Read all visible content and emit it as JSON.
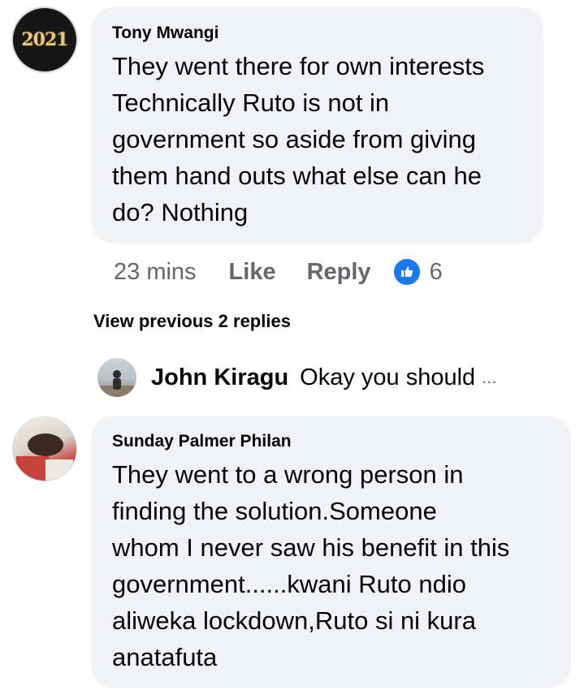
{
  "comments": [
    {
      "author": "Tony Mwangi",
      "avatar_text": "2021",
      "text": "They went there for own interests\nTechnically Ruto is not in\ngovernment so aside from giving\nthem hand outs what else can he\ndo? Nothing",
      "time": "23 mins",
      "like_label": "Like",
      "reply_label": "Reply",
      "reaction_icon": "thumbs-up-icon",
      "reaction_count": "6",
      "view_previous": "View previous 2 replies",
      "latest_reply": {
        "author": "John Kiragu",
        "text": "Okay you should",
        "ellipsis": "..."
      }
    },
    {
      "author": "Sunday Palmer Philan",
      "text": "They went to a wrong person in\nfinding the solution.Someone\nwhom I never saw his benefit in this\ngovernment......kwani Ruto ndio\naliweka lockdown,Ruto si ni kura\nanatafuta"
    }
  ],
  "colors": {
    "bubble": "#f0f2f5",
    "meta": "#65676b",
    "reaction_blue": "#1877f2"
  }
}
